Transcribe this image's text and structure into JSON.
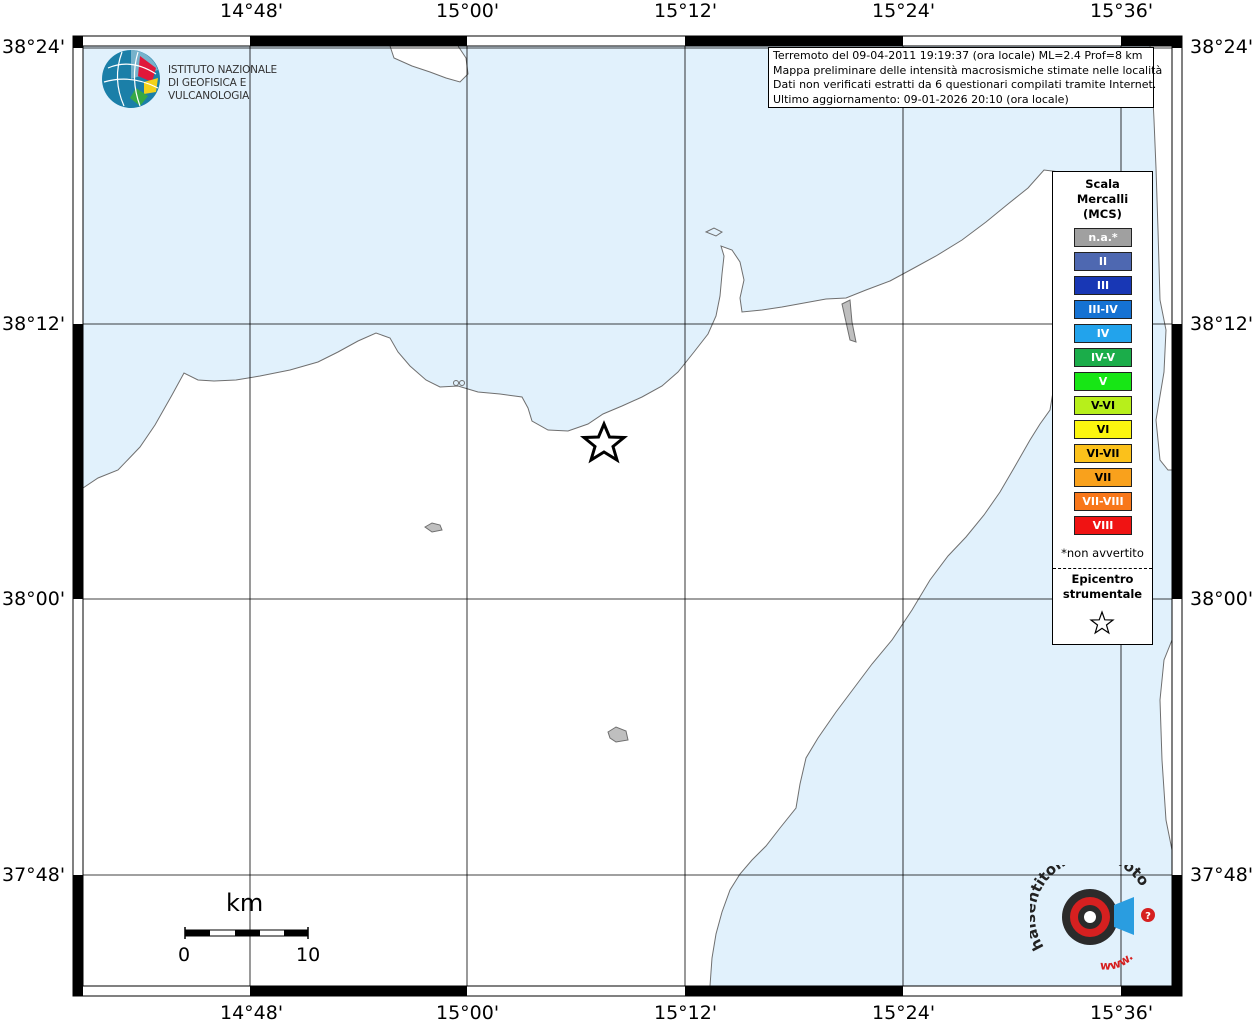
{
  "map": {
    "title_lines": [
      "Terremoto del 09-04-2011 19:19:37 (ora locale) ML=2.4 Prof=8 km",
      "Mappa preliminare delle intensità macrosismiche stimate nelle località",
      "Dati non verificati estratti da 6 questionari compilati tramite Internet.",
      "Ultimo aggiornamento: 09-01-2026 20:10 (ora locale)"
    ],
    "lon_ticks": [
      "14°48'",
      "15°00'",
      "15°12'",
      "15°24'",
      "15°36'"
    ],
    "lat_ticks": [
      "38°24'",
      "38°12'",
      "38°00'",
      "37°48'"
    ],
    "colors": {
      "sea": "#e1f1fc",
      "land": "#ffffff",
      "coast": "#7a7a7a",
      "grid": "#000000"
    }
  },
  "logo": {
    "line1": "ISTITUTO NAZIONALE",
    "line2": "DI GEOFISICA E VULCANOLOGIA"
  },
  "legend": {
    "title_lines": [
      "Scala",
      "Mercalli",
      "(MCS)"
    ],
    "classes": [
      {
        "label": "n.a.*",
        "color": "#a0a0a0"
      },
      {
        "label": "II",
        "color": "#4e68b1"
      },
      {
        "label": "III",
        "color": "#1837b5"
      },
      {
        "label": "III-IV",
        "color": "#1572d3"
      },
      {
        "label": "IV",
        "color": "#22a3ec"
      },
      {
        "label": "IV-V",
        "color": "#1bad4a"
      },
      {
        "label": "V",
        "color": "#17e615"
      },
      {
        "label": "V-VI",
        "color": "#b7ef1b"
      },
      {
        "label": "VI",
        "color": "#fbf60f"
      },
      {
        "label": "VI-VII",
        "color": "#fbc11b"
      },
      {
        "label": "VII",
        "color": "#f9a11c"
      },
      {
        "label": "VII-VIII",
        "color": "#f8771a"
      },
      {
        "label": "VIII",
        "color": "#f01313"
      }
    ],
    "note": "*non avvertito",
    "epicenter_lines": [
      "Epicentro",
      "strumentale"
    ]
  },
  "scalebar": {
    "unit": "km",
    "min": "0",
    "max": "10"
  },
  "watermark": {
    "top": "haisentitoilterremoto.it",
    "bottom": "www.",
    "symbol": "?"
  }
}
